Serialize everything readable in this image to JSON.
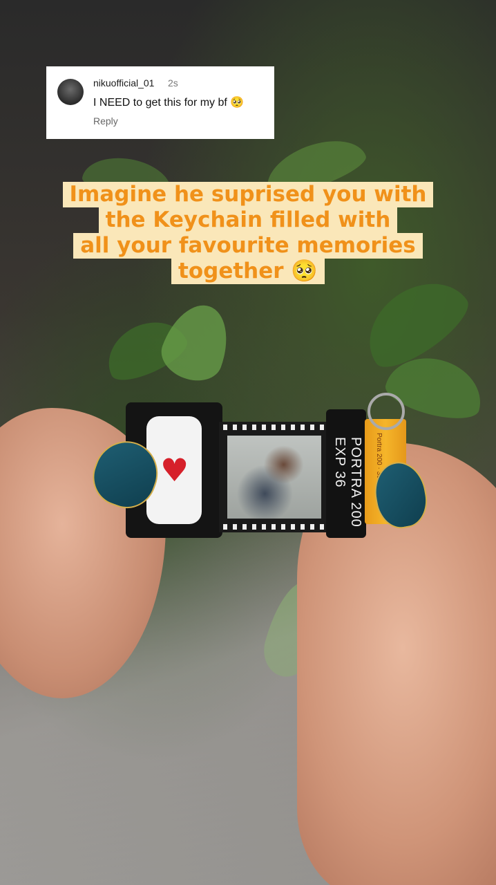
{
  "comment": {
    "username": "nikuofficial_01",
    "time": "2s",
    "text": "I NEED to get this for my bf 🥺",
    "reply_label": "Reply"
  },
  "caption": {
    "lines": [
      "Imagine he suprised you with",
      "the Keychain filled with",
      "all your favourite memories",
      "together 🥺"
    ]
  },
  "product": {
    "canister_text": "PORTRA 200 EXP 36",
    "canister_small_text": "Portra 200 · 36"
  },
  "colors": {
    "caption_text": "#f0911a",
    "caption_bg": "#fae7b9",
    "comment_bg": "#ffffff"
  }
}
